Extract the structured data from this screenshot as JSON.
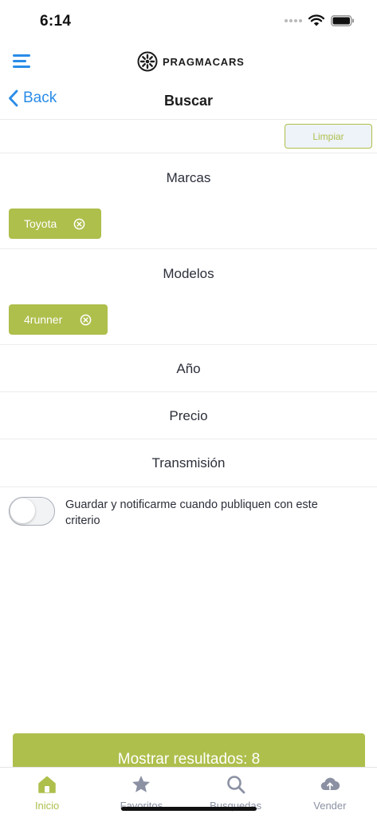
{
  "status_bar": {
    "time": "6:14"
  },
  "header": {
    "brand": "PRAGMACARS"
  },
  "nav": {
    "back_label": "Back",
    "title": "Buscar"
  },
  "filters": {
    "clear_label": "Limpiar",
    "brands": {
      "title": "Marcas",
      "chips": [
        "Toyota"
      ]
    },
    "models": {
      "title": "Modelos",
      "chips": [
        "4runner"
      ]
    },
    "year": {
      "title": "Año"
    },
    "price": {
      "title": "Precio"
    },
    "transmission": {
      "title": "Transmisión"
    }
  },
  "notify": {
    "label": "Guardar y notificarme cuando publiquen con este criterio",
    "enabled": false
  },
  "results_button": {
    "label": "Mostrar resultados: 8"
  },
  "tabs": [
    {
      "label": "Inicio",
      "icon": "home-icon",
      "active": true
    },
    {
      "label": "Favoritos",
      "icon": "star-icon",
      "active": false
    },
    {
      "label": "Busquedas",
      "icon": "search-icon",
      "active": false
    },
    {
      "label": "Vender",
      "icon": "cloud-upload-icon",
      "active": false
    }
  ],
  "colors": {
    "accent": "#aebf4c",
    "link": "#2a8ce8",
    "text": "#2c2f3a",
    "tab_inactive": "#8b91a3"
  }
}
